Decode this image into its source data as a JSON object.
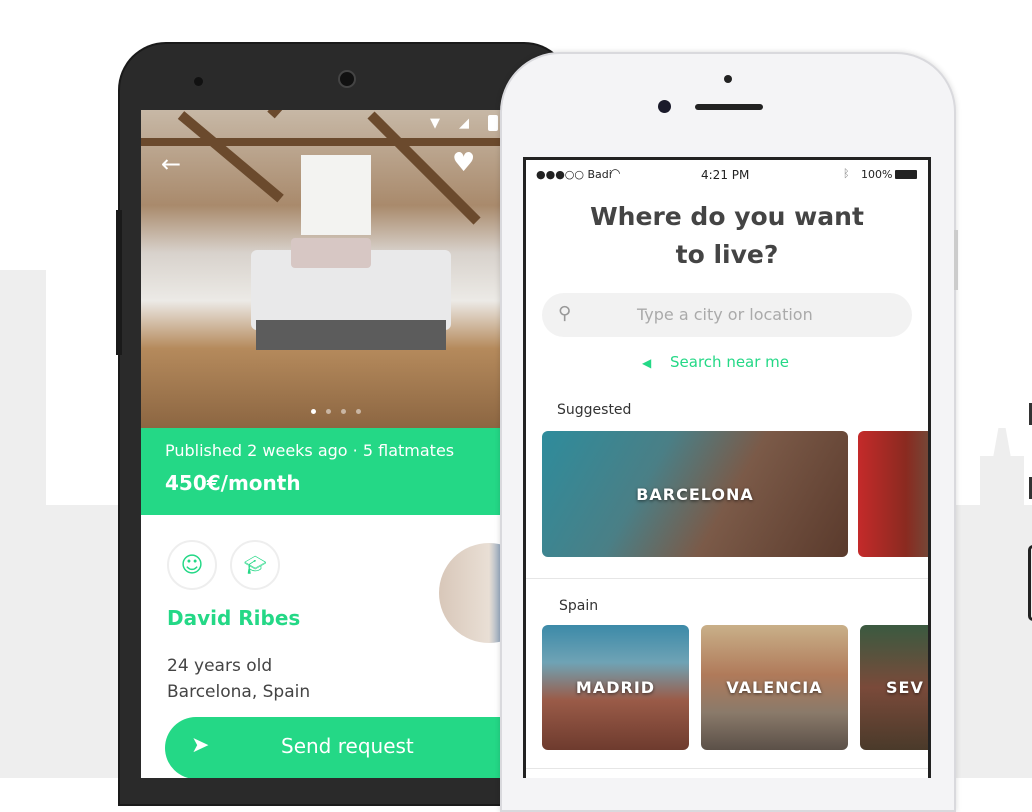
{
  "colors": {
    "accent": "#24d886",
    "text": "#444444"
  },
  "android": {
    "status_icons": [
      "wifi-icon",
      "signal-icon",
      "battery-icon"
    ],
    "back_icon": "arrow-left-icon",
    "favorite_icon": "heart-icon",
    "photo_pages": 4,
    "photo_current_page": 1,
    "meta": "Published 2 weeks ago · 5 flatmates",
    "price": "450€/month",
    "badges": [
      "face-icon",
      "graduation-cap-icon"
    ],
    "name": "David Ribes",
    "age": "24 years old",
    "location": "Barcelona, Spain",
    "send_request": "Send request"
  },
  "iphone": {
    "status": {
      "carrier": "●●●○○ Badi",
      "time": "4:21 PM",
      "battery": "100%"
    },
    "title_line1": "Where do you want",
    "title_line2": "to live?",
    "search_placeholder": "Type a city or location",
    "search_near": "Search near me",
    "suggested_label": "Suggested",
    "suggested": [
      "BARCELONA"
    ],
    "spain_label": "Spain",
    "spain": [
      "MADRID",
      "VALENCIA",
      "SEV"
    ]
  }
}
